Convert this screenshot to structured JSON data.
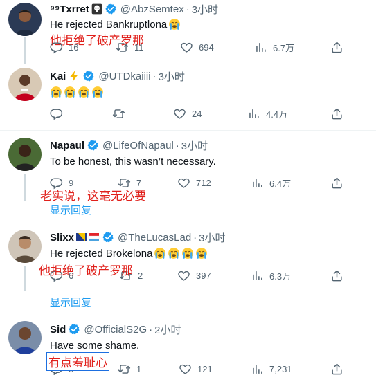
{
  "tweets": [
    {
      "name": "⁹⁹Txrret",
      "emoji": "☠",
      "handle": "@AbzSemtex",
      "dot": "·",
      "time": "3小时",
      "text": "He rejected Bankruptlona",
      "cry_count": 1,
      "annotation": "他拒绝了破产罗那",
      "replies": "16",
      "retweets": "11",
      "likes": "694",
      "views": "6.7万",
      "avatar_color": "#2b3a55"
    },
    {
      "name": "Kai",
      "emoji": "⚡",
      "handle": "@UTDkaiiii",
      "dot": "·",
      "time": "3小时",
      "text": "",
      "cry_count": 4,
      "annotation": "",
      "replies": "",
      "retweets": "",
      "likes": "24",
      "views": "4.4万",
      "avatar_color": "#b3001b"
    },
    {
      "name": "Napaul",
      "emoji": "",
      "handle": "@LifeOfNapaul",
      "dot": "·",
      "time": "3小时",
      "text": "To be honest, this wasn’t necessary.",
      "cry_count": 0,
      "annotation": "老实说，这毫无必要",
      "replies": "9",
      "retweets": "7",
      "likes": "712",
      "views": "6.4万",
      "show_replies": "显示回复",
      "avatar_color": "#3a5a2a"
    },
    {
      "name": "Slixx",
      "emoji": "🇧🇦🇱🇺",
      "handle": "@TheLucasLad",
      "dot": "·",
      "time": "3小时",
      "text": "He rejected Brokelona",
      "cry_count": 4,
      "annotation": "他拒绝了破产罗那",
      "replies": "6",
      "retweets": "2",
      "likes": "397",
      "views": "6.3万",
      "show_replies": "显示回复",
      "avatar_color": "#5a4a3a"
    },
    {
      "name": "Sid",
      "emoji": "",
      "handle": "@OfficialS2G",
      "dot": "·",
      "time": "2小时",
      "text": "Have some shame.",
      "cry_count": 0,
      "annotation": "有点羞耻心",
      "replies": "3",
      "retweets": "1",
      "likes": "121",
      "views": "7,231",
      "avatar_color": "#2b4aa0"
    }
  ],
  "colors": {
    "verified": "#1d9bf0",
    "annotation": "#e0201b",
    "muted": "#536471",
    "link": "#1d9bf0"
  }
}
